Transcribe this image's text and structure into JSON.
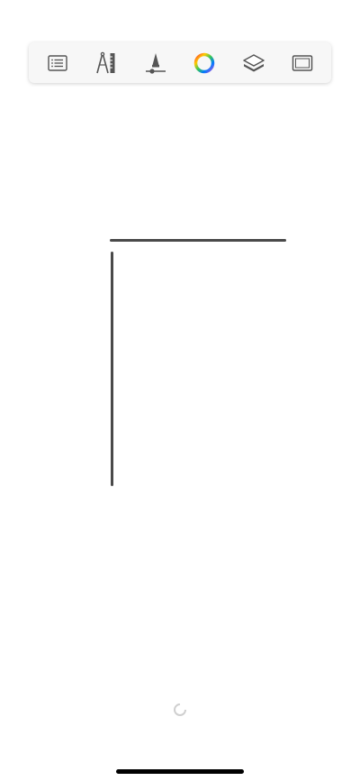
{
  "toolbar": {
    "tools": [
      {
        "name": "list-icon"
      },
      {
        "name": "ruler-compass-icon"
      },
      {
        "name": "brush-size-icon"
      },
      {
        "name": "color-wheel-icon"
      },
      {
        "name": "layers-icon"
      },
      {
        "name": "canvas-frame-icon"
      }
    ]
  },
  "canvas": {
    "strokes": [
      {
        "type": "horizontal-line",
        "color": "#2a2a2a"
      },
      {
        "type": "vertical-line",
        "color": "#2a2a2a"
      }
    ]
  },
  "status": {
    "loading_indicator": "spinner-icon"
  },
  "colors": {
    "background": "#ffffff",
    "toolbar_bg": "#f7f7f7",
    "icon": "#555555",
    "stroke": "#2a2a2a"
  }
}
